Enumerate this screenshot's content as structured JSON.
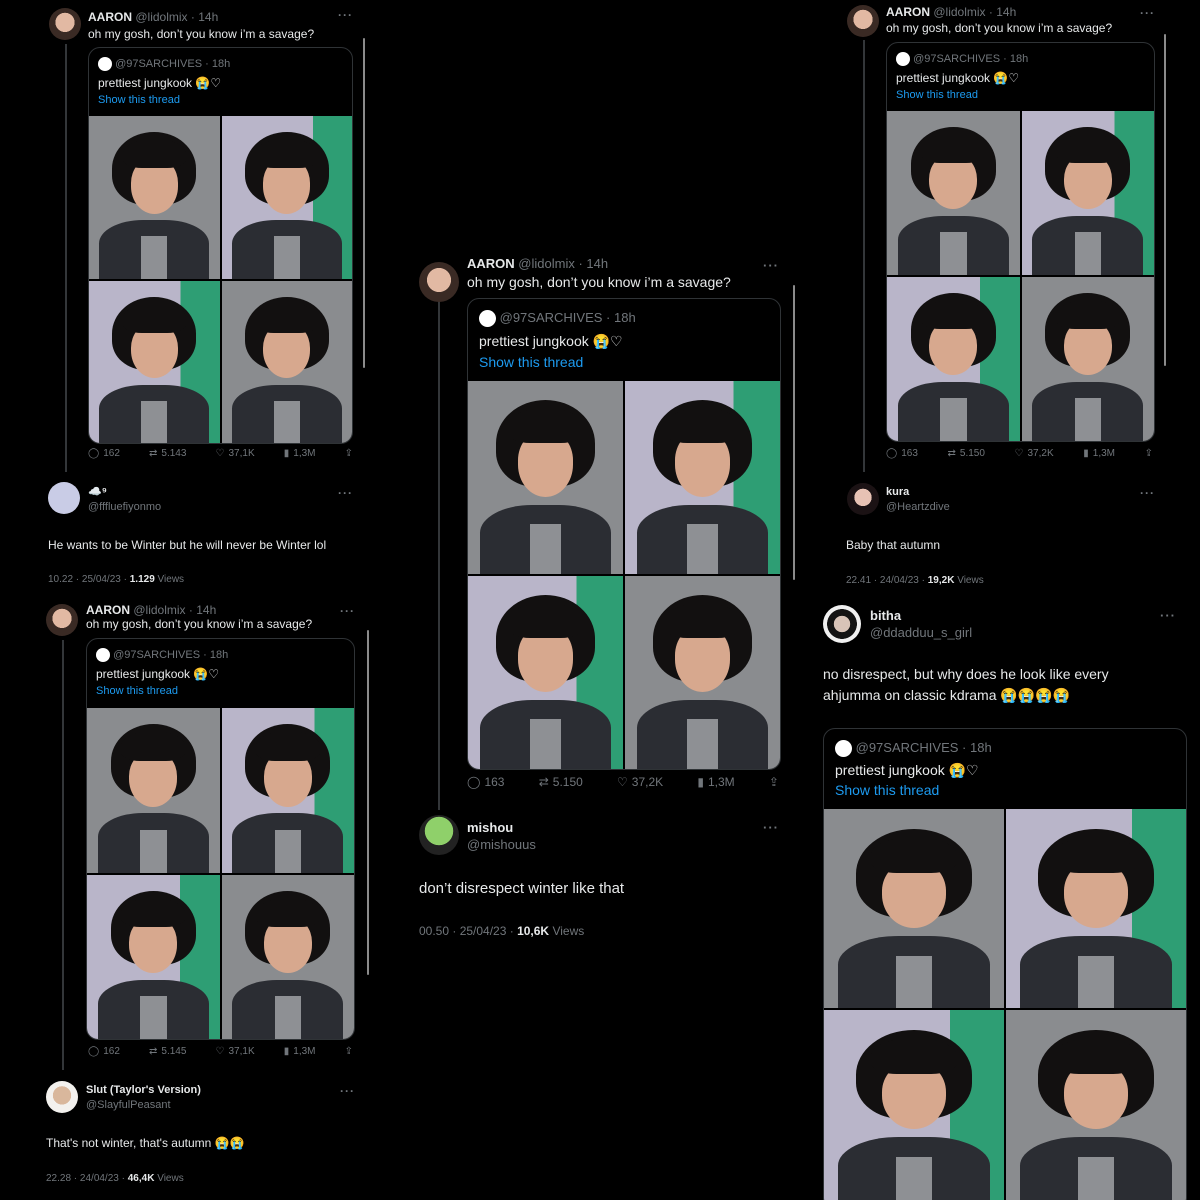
{
  "original_tweet": {
    "author_name": "AARON",
    "handle": "@lidolmix",
    "time_14h": "· 14h",
    "text": "oh my gosh, don’t you know i’m a savage?",
    "quote": {
      "handle": "@97SARCHIVES",
      "time": "· 18h",
      "text": "prettiest jungkook 😭♡",
      "show_thread": "Show this thread"
    }
  },
  "panels": [
    {
      "stats": {
        "replies": "162",
        "retweets": "5.143",
        "likes": "37,1K",
        "views": "1,3M"
      },
      "reply": {
        "author_name": "☁️⁹",
        "handle": "@fffluefiyonmo",
        "text": "He wants to be Winter but he will never be Winter lol",
        "timestamp": "10.22 · 25/04/23 ·",
        "views_count": "1.129",
        "views_label": "Views"
      }
    },
    {
      "stats": {
        "replies": "162",
        "retweets": "5.145",
        "likes": "37,1K",
        "views": "1,3M"
      },
      "reply": {
        "author_name": "Slut (Taylor's Version)",
        "handle": "@SlayfulPeasant",
        "text": "That's not winter, that's autumn 😭😭",
        "timestamp": "22.28 · 24/04/23 ·",
        "views_count": "46,4K",
        "views_label": "Views"
      }
    },
    {
      "stats": {
        "replies": "163",
        "retweets": "5.150",
        "likes": "37,2K",
        "views": "1,3M"
      },
      "reply": {
        "author_name": "mishou",
        "handle": "@mishouus",
        "text": "don’t disrespect winter like that",
        "timestamp": "00.50 · 25/04/23 ·",
        "views_count": "10,6K",
        "views_label": "Views"
      }
    },
    {
      "stats": {
        "replies": "163",
        "retweets": "5.150",
        "likes": "37,2K",
        "views": "1,3M"
      },
      "reply": {
        "author_name": "kura",
        "handle": "@Heartzdive",
        "text": "Baby that autumn",
        "timestamp": "22.41 · 24/04/23 ·",
        "views_count": "19,2K",
        "views_label": "Views"
      }
    },
    {
      "reply": {
        "author_name": "bitha",
        "handle": "@ddadduu_s_girl",
        "text_line1": "no disrespect, but why does he look like every",
        "text_line2": "ahjumma on classic kdrama 😭😭😭😭"
      }
    }
  ],
  "icons": {
    "reply": "reply-icon",
    "retweet": "retweet-icon",
    "like": "heart-icon",
    "views": "views-chart-icon",
    "share": "share-icon",
    "more": "more-dots-icon"
  },
  "colors": {
    "background": "#000000",
    "text": "#e7e9ea",
    "muted": "#71767b",
    "link": "#1d9bf0",
    "border": "#2f3336"
  }
}
